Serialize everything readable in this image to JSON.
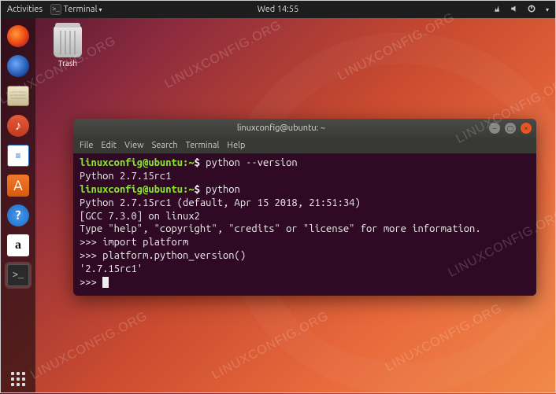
{
  "topbar": {
    "activities": "Activities",
    "app_menu": "Terminal",
    "clock": "Wed 14:55"
  },
  "desktop": {
    "trash_label": "Trash"
  },
  "terminal": {
    "title": "linuxconfig@ubuntu: ~",
    "menus": [
      "File",
      "Edit",
      "View",
      "Search",
      "Terminal",
      "Help"
    ],
    "prompt_user": "linuxconfig@ubuntu",
    "prompt_path": "~",
    "lines": {
      "cmd1": "python --version",
      "out1": "Python 2.7.15rc1",
      "cmd2": "python",
      "out2a": "Python 2.7.15rc1 (default, Apr 15 2018, 21:51:34)",
      "out2b": "[GCC 7.3.0] on linux2",
      "out2c": "Type \"help\", \"copyright\", \"credits\" or \"license\" for more information.",
      "py1": ">>> import platform",
      "py2": ">>> platform.python_version()",
      "py3": "'2.7.15rc1'",
      "py4": ">>> "
    }
  },
  "watermark": "LINUXCONFIG.ORG"
}
